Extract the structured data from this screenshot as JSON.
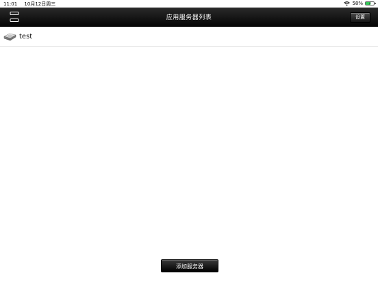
{
  "status_bar": {
    "time": "11:01",
    "date": "10月12日周三",
    "battery_percent_text": "58%",
    "battery_level": 0.58,
    "icons": [
      "wifi-icon",
      "battery-charging-icon"
    ]
  },
  "nav_bar": {
    "title": "应用服务器列表",
    "settings_label": "设置",
    "menu_icon": "menu-icon"
  },
  "servers": [
    {
      "name": "test",
      "icon": "server-disk-icon"
    }
  ],
  "footer": {
    "add_server_label": "添加服务器"
  },
  "colors": {
    "nav_background": "#111111",
    "battery_fill": "#35c759",
    "divider": "#e6e6e6"
  }
}
